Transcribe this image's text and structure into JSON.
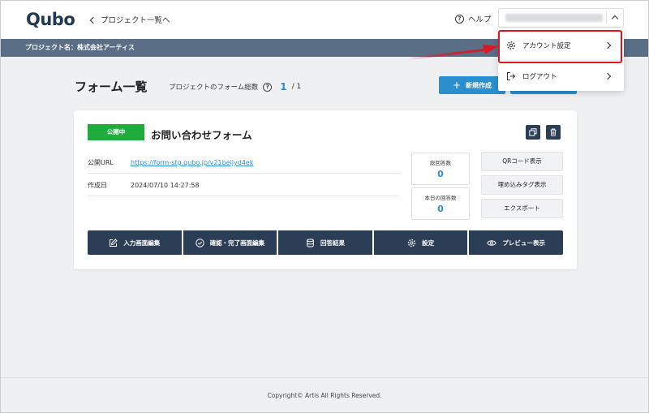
{
  "header": {
    "logo": "Qubo",
    "back_link": "プロジェクト一覧へ",
    "help_label": "ヘルプ"
  },
  "project_bar": {
    "label": "プロジェクト名：株式会社アーティス"
  },
  "main": {
    "title": "フォーム一覧",
    "total_label": "プロジェクトのフォーム総数",
    "total_count": "1",
    "total_of": "/ 1",
    "new_button": "新規作成"
  },
  "card": {
    "status": "公開中",
    "name": "お問い合わせフォーム",
    "url_label": "公開URL",
    "url_value": "https://form-stg.qubo.jp/v21beijyd4ek",
    "created_label": "作成日",
    "created_value": "2024/07/10 14:27:58",
    "total_answers_label": "総回答数",
    "total_answers_value": "0",
    "today_answers_label": "本日の回答数",
    "today_answers_value": "0",
    "qr_button": "QRコード表示",
    "embed_button": "埋め込みタグ表示",
    "export_button": "エクスポート",
    "actions": {
      "edit_input": "入力画面編集",
      "edit_confirm": "確認・完了画面編集",
      "answers": "回答結果",
      "settings": "設定",
      "preview": "プレビュー表示"
    }
  },
  "dropdown": {
    "account_settings": "アカウント設定",
    "logout": "ログアウト"
  },
  "footer": {
    "copyright": "Copyright© Artis All Rights Reserved."
  },
  "colors": {
    "primary": "#2b8fce",
    "navy": "#2c3e55",
    "status_green": "#1fac3c",
    "highlight_red": "#e1141e"
  }
}
